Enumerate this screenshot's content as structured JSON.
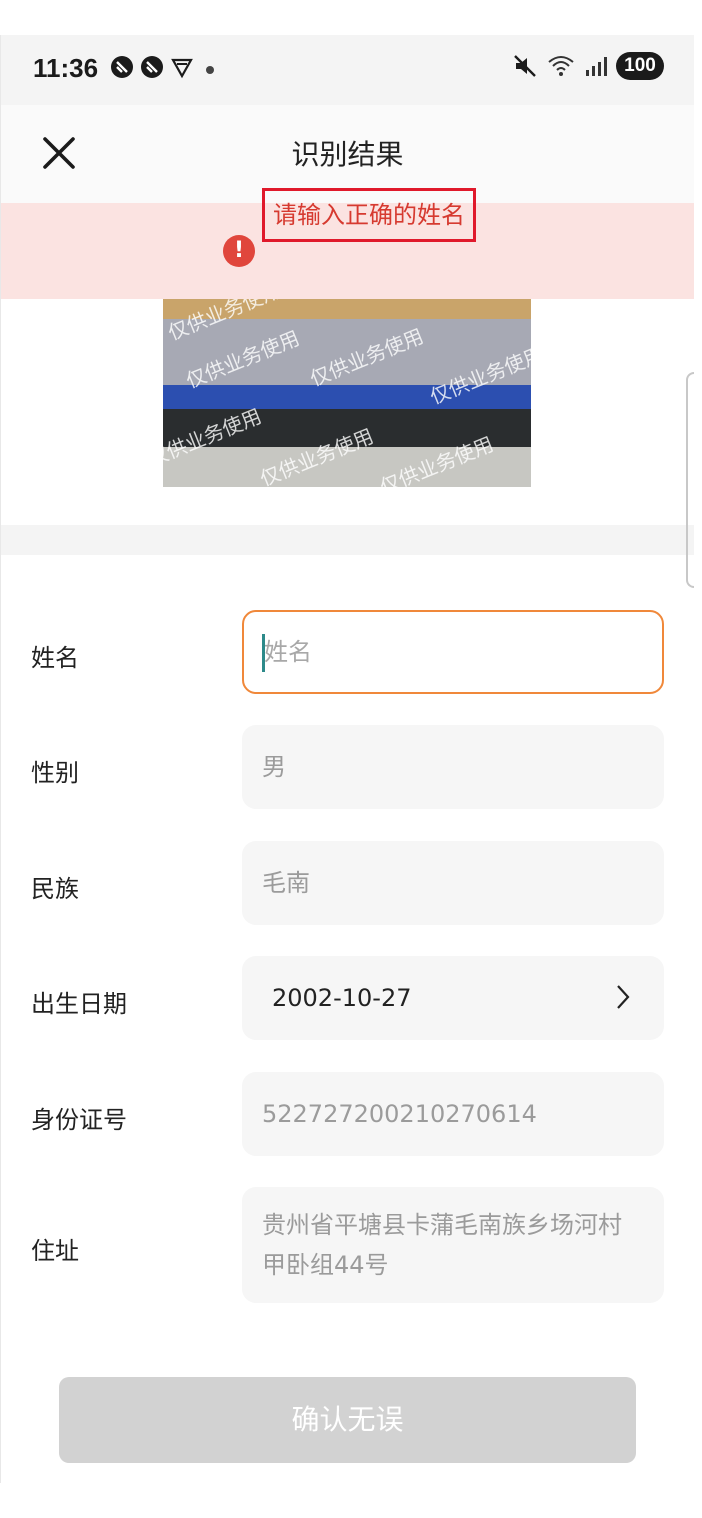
{
  "status_bar": {
    "time": "11:36",
    "left_icons": [
      "vpn-icon",
      "vpn-icon",
      "shield-icon",
      "dot-icon"
    ],
    "right_icons": [
      "mute-icon",
      "wifi-icon",
      "signal-icon"
    ],
    "battery": "100"
  },
  "nav": {
    "title": "识别结果",
    "close_icon": "close-icon"
  },
  "error": {
    "icon": "!",
    "message": "请输入正确的姓名",
    "color": "#e0463c"
  },
  "watermark": "仅供业务使用",
  "form": {
    "name": {
      "label": "姓名",
      "value": "",
      "placeholder": "姓名"
    },
    "gender": {
      "label": "性别",
      "value": "男"
    },
    "ethnicity": {
      "label": "民族",
      "value": "毛南"
    },
    "birth_date": {
      "label": "出生日期",
      "value": "2002-10-27"
    },
    "id_number": {
      "label": "身份证号",
      "value": "522727200210270614"
    },
    "address": {
      "label": "住址",
      "value": "贵州省平塘县卡蒲毛南族乡场河村甲卧组44号"
    }
  },
  "confirm_button": "确认无误",
  "colors": {
    "accent": "#f0883a",
    "error_banner": "#fbe3e1",
    "error_text": "#d63a30",
    "disabled_button": "#d2d2d2"
  }
}
